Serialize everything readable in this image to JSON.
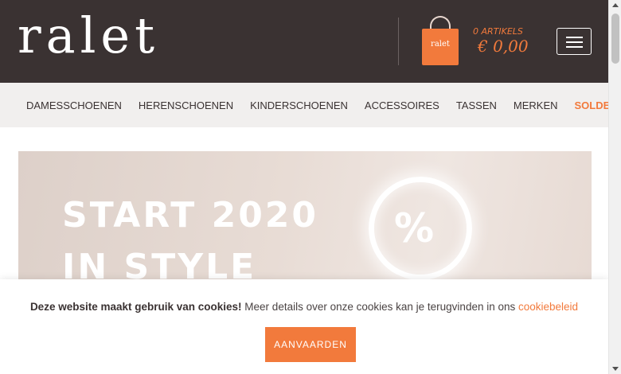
{
  "header": {
    "logo": "ralet",
    "bag_label": "ralet",
    "cart_count": "0 ARTIKELS",
    "cart_total": "€ 0,00"
  },
  "nav": {
    "items": [
      {
        "label": "DAMESSCHOENEN"
      },
      {
        "label": "HERENSCHOENEN"
      },
      {
        "label": "KINDERSCHOENEN"
      },
      {
        "label": "ACCESSOIRES"
      },
      {
        "label": "TASSEN"
      },
      {
        "label": "MERKEN"
      },
      {
        "label": "SOLDEN"
      }
    ]
  },
  "banner": {
    "line1": "START 2020",
    "line2": "IN STYLE",
    "percent": "%"
  },
  "cookie": {
    "bold_text": "Deze website maakt gebruik van cookies!",
    "text": " Meer details over onze cookies kan je terugvinden in ons ",
    "link": "cookiebeleid",
    "accept_label": "AANVAARDEN"
  },
  "colors": {
    "header_bg": "#3a3232",
    "accent": "#f27a3c",
    "nav_bg": "#f1efee"
  },
  "icons": [
    "shopping-bag-icon",
    "hamburger-menu-icon"
  ]
}
